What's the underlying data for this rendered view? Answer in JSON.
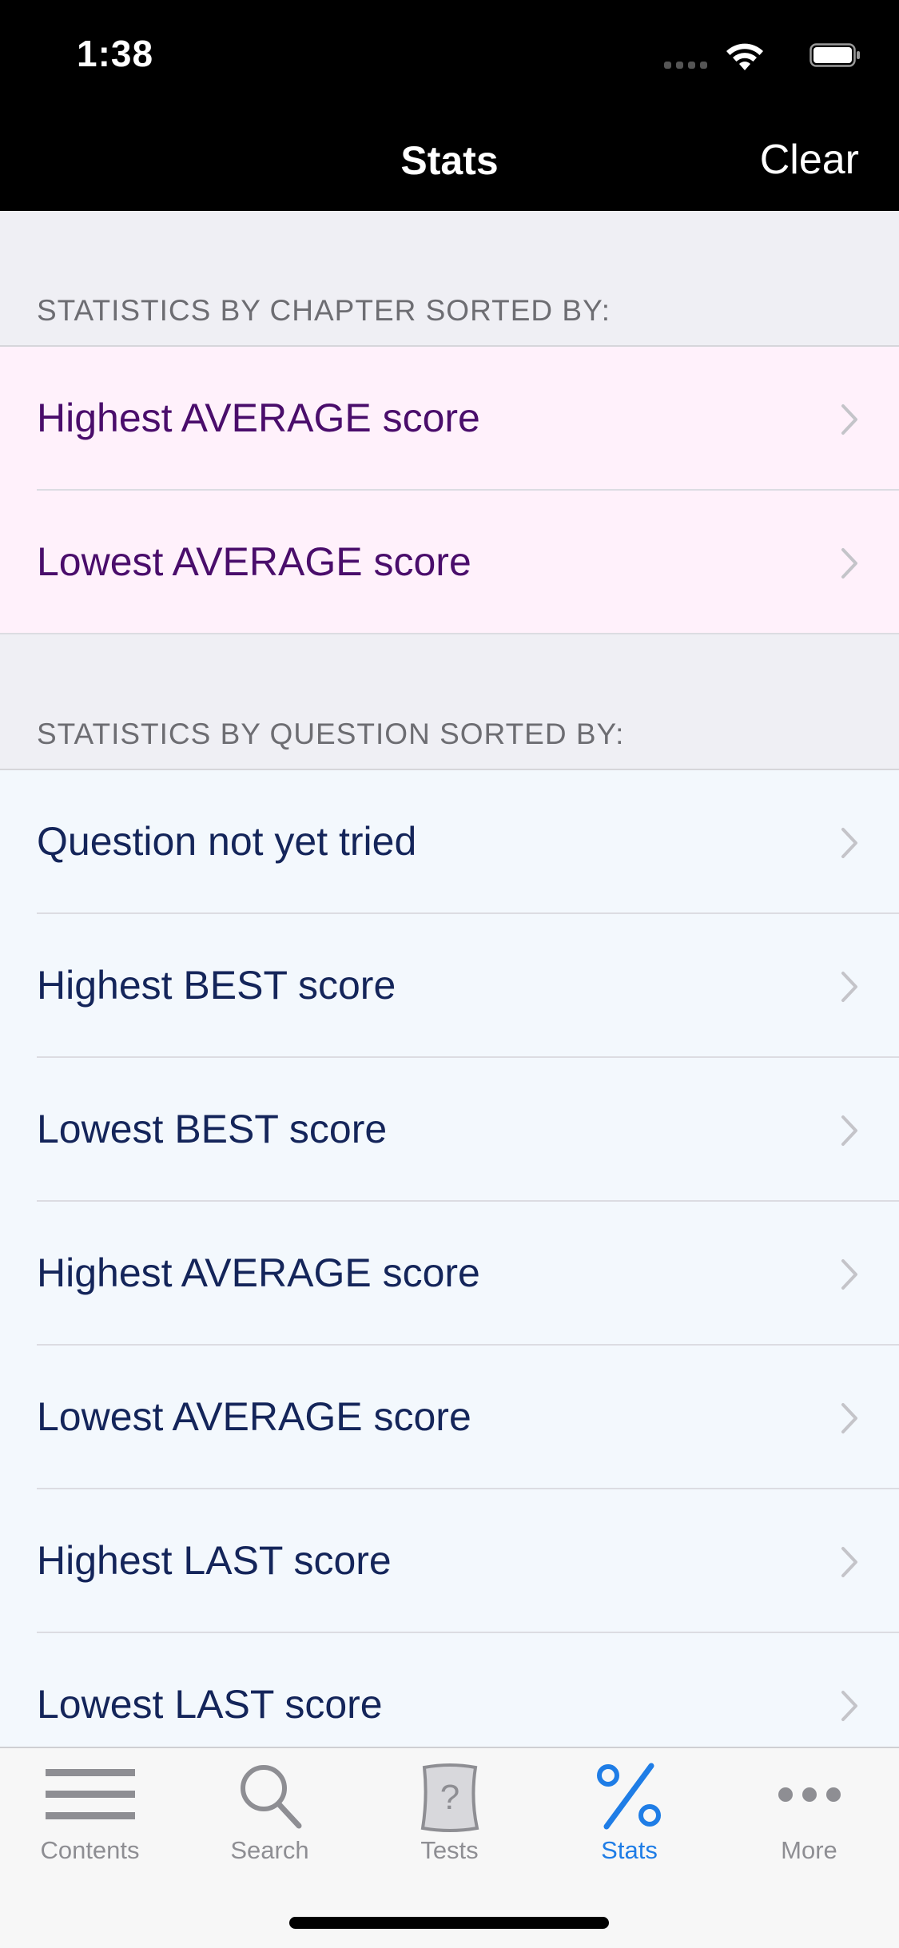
{
  "status_bar": {
    "time": "1:38"
  },
  "nav": {
    "title": "Stats",
    "right_button": "Clear"
  },
  "sections": {
    "chapter": {
      "header": "STATISTICS BY CHAPTER SORTED BY:",
      "rows": [
        "Highest AVERAGE score",
        "Lowest AVERAGE score"
      ]
    },
    "question": {
      "header": "STATISTICS BY QUESTION SORTED BY:",
      "rows": [
        "Question not yet tried",
        "Highest BEST score",
        "Lowest BEST score",
        "Highest AVERAGE score",
        "Lowest AVERAGE score",
        "Highest LAST score",
        "Lowest LAST score"
      ]
    }
  },
  "tabbar": {
    "tabs": [
      {
        "label": "Contents",
        "icon": "list-icon"
      },
      {
        "label": "Search",
        "icon": "search-icon"
      },
      {
        "label": "Tests",
        "icon": "question-page-icon"
      },
      {
        "label": "Stats",
        "icon": "percent-icon"
      },
      {
        "label": "More",
        "icon": "more-icon"
      }
    ],
    "active": "Stats"
  },
  "colors": {
    "chapter_row_bg": "#fff1fb",
    "chapter_text": "#4a0d6b",
    "question_row_bg": "#f3f8fd",
    "question_text": "#14255a",
    "active_tab": "#1f7de6"
  }
}
